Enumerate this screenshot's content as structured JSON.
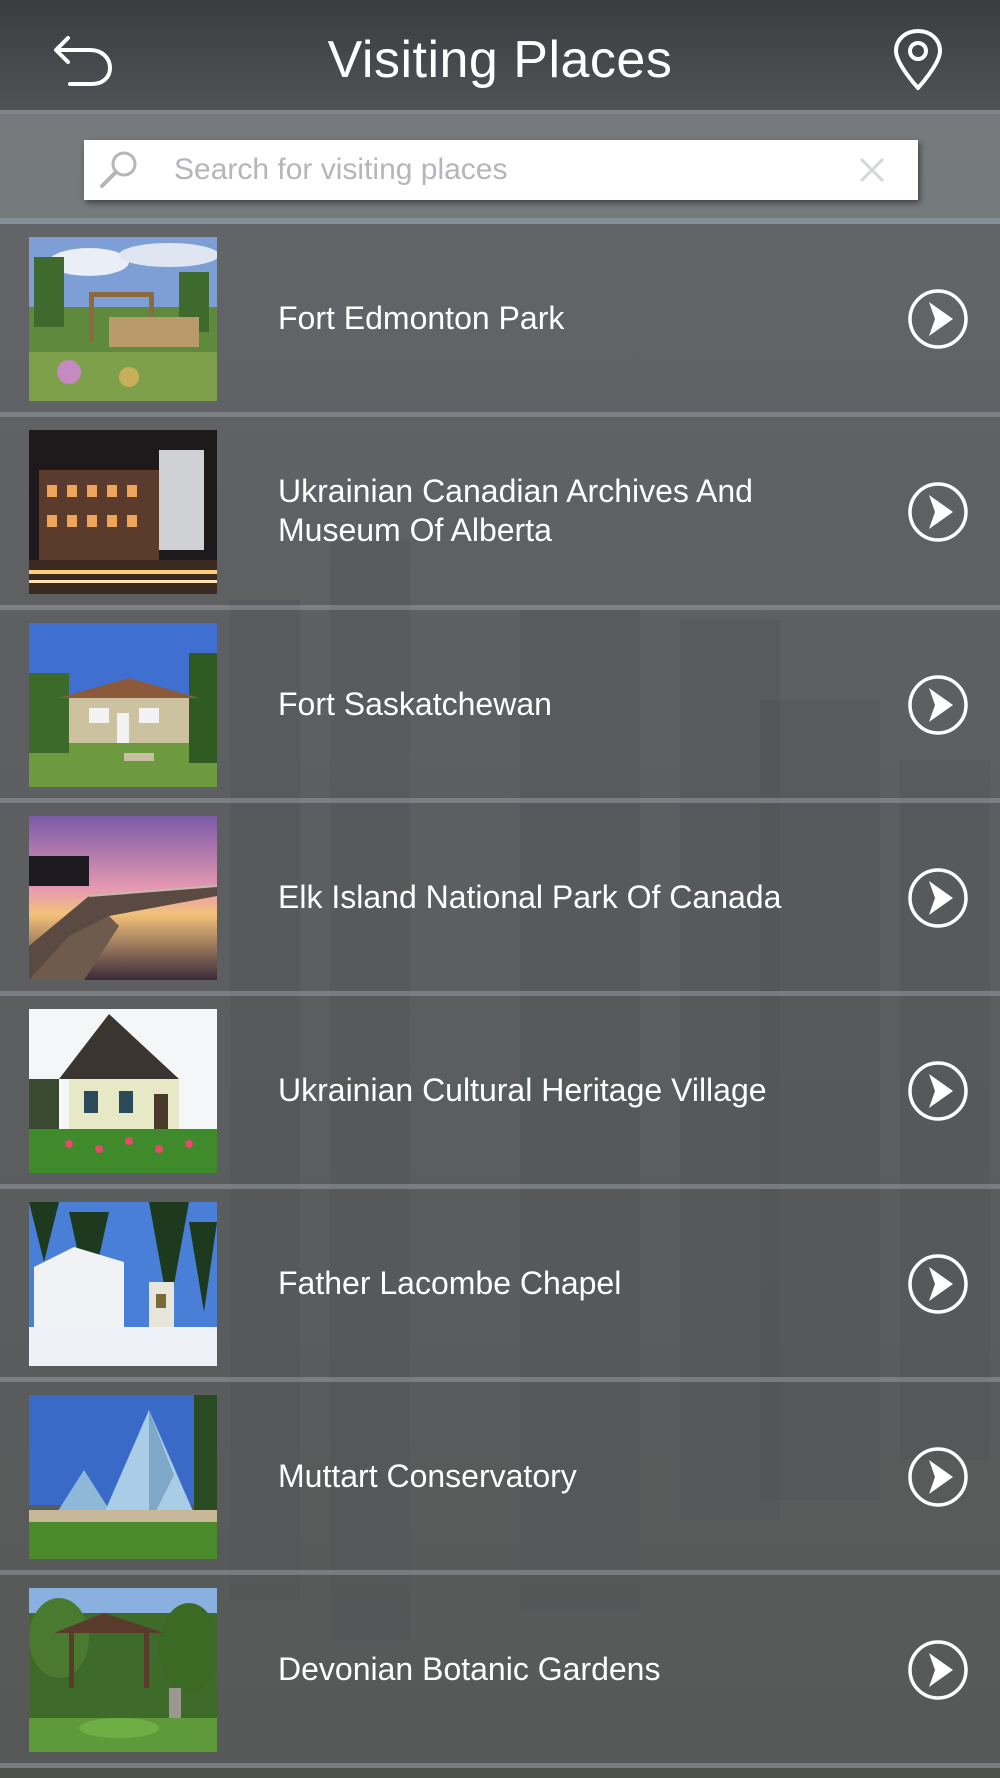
{
  "header": {
    "title": "Visiting Places",
    "back_icon": "back-arrow-icon",
    "map_icon": "map-pin-icon"
  },
  "search": {
    "placeholder": "Search for visiting places",
    "value": ""
  },
  "places": [
    {
      "name": "Fort Edmonton Park"
    },
    {
      "name": "Ukrainian Canadian Archives And Museum Of Alberta"
    },
    {
      "name": "Fort Saskatchewan"
    },
    {
      "name": "Elk Island National Park Of Canada"
    },
    {
      "name": "Ukrainian Cultural Heritage Village"
    },
    {
      "name": "Father Lacombe Chapel"
    },
    {
      "name": "Muttart Conservatory"
    },
    {
      "name": "Devonian Botanic Gardens"
    }
  ],
  "colors": {
    "header_bg": "#3a3c3f",
    "accent_divider": "#7f8489",
    "text": "#ffffff"
  }
}
